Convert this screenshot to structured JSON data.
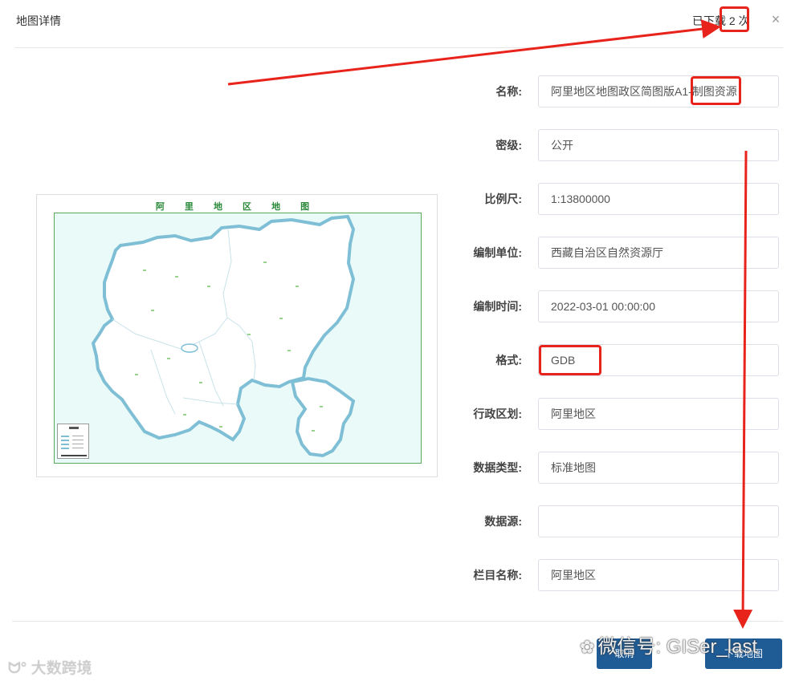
{
  "dialog": {
    "title": "地图详情",
    "download_count": "已下载 2 次",
    "close_icon": "×"
  },
  "map_preview": {
    "map_title": "阿 里 地 区 地 图",
    "land_color": "#ffffff",
    "water_color": "#eafaf8",
    "border_color": "#7fbfd6",
    "frame_color": "#5aa85a"
  },
  "form": {
    "fields": [
      {
        "label": "名称:",
        "value": "阿里地区地图政区简图版A1-制图资源"
      },
      {
        "label": "密级:",
        "value": "公开"
      },
      {
        "label": "比例尺:",
        "value": "1:13800000"
      },
      {
        "label": "编制单位:",
        "value": "西藏自治区自然资源厅"
      },
      {
        "label": "编制时间:",
        "value": "2022-03-01 00:00:00"
      },
      {
        "label": "格式:",
        "value": "GDB"
      },
      {
        "label": "行政区划:",
        "value": "阿里地区"
      },
      {
        "label": "数据类型:",
        "value": "标准地图"
      },
      {
        "label": "数据源:",
        "value": ""
      },
      {
        "label": "栏目名称:",
        "value": "阿里地区"
      }
    ]
  },
  "footer": {
    "cancel_label": "取消",
    "download_label": "下载地图"
  },
  "watermarks": {
    "wechat": "微信号: GISer_last",
    "wechat_icon": "wechat-icon",
    "brand": "大数跨境"
  },
  "annotation_color": "#e8231b"
}
